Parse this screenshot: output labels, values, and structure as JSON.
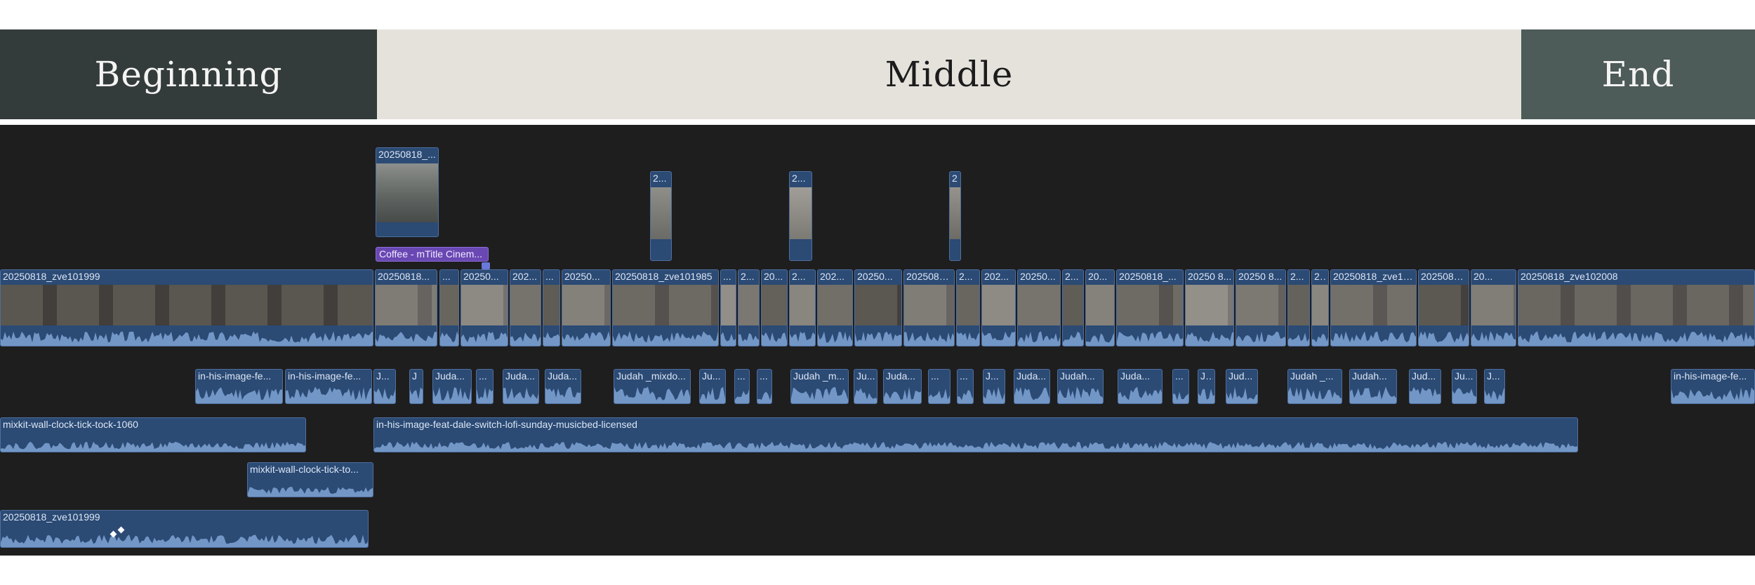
{
  "sections": {
    "beginning": "Beginning",
    "middle": "Middle",
    "end": "End"
  },
  "colors": {
    "beginning_bg": "#343c3b",
    "middle_bg": "#e5e2dc",
    "end_bg": "#4d5b59",
    "timeline_bg": "#1e1e1f",
    "clip_bg": "#2b4a74",
    "title_bg": "#6a48b3"
  },
  "connected_clips": [
    "20250818_...",
    "2...",
    "2...",
    "2"
  ],
  "title_clip": "Coffee - mTitle Cinem...",
  "primary_clips": [
    "20250818_zve101999",
    "20250818...",
    "...",
    "20250...",
    "202...",
    "...",
    "20250...",
    "20250818_zve101985",
    "...",
    "2...",
    "20...",
    "2...",
    "202...",
    "20250...",
    "2025081...",
    "2...",
    "202...",
    "20250...",
    "2...",
    "20...",
    "20250818_...",
    "20250 8...",
    "20250 8...",
    "2...",
    "2...",
    "20250818_zve101...",
    "2025081...",
    "20...",
    "20250818_zve102008"
  ],
  "audio_clips": [
    "in-his-image-fe...",
    "in-his-image-fe...",
    "J...",
    "J",
    "Juda...",
    "...",
    "Juda...",
    "Juda...",
    "Judah _mixdo...",
    "Ju...",
    "...",
    "...",
    "Judah _m...",
    "Ju...",
    "Juda...",
    "...",
    "...",
    "J...",
    "Juda...",
    "Judah...",
    "Juda...",
    "...",
    "J...",
    "Jud...",
    "Judah _...",
    "Judah...",
    "Jud...",
    "Ju...",
    "J...",
    "in-his-image-fe..."
  ],
  "music_clip": "in-his-image-feat-dale-switch-lofi-sunday-musicbed-licensed",
  "sfx_clips": [
    "mixkit-wall-clock-tick-tock-1060",
    "mixkit-wall-clock-tick-to..."
  ],
  "bottom_clip": "20250818_zve101999"
}
